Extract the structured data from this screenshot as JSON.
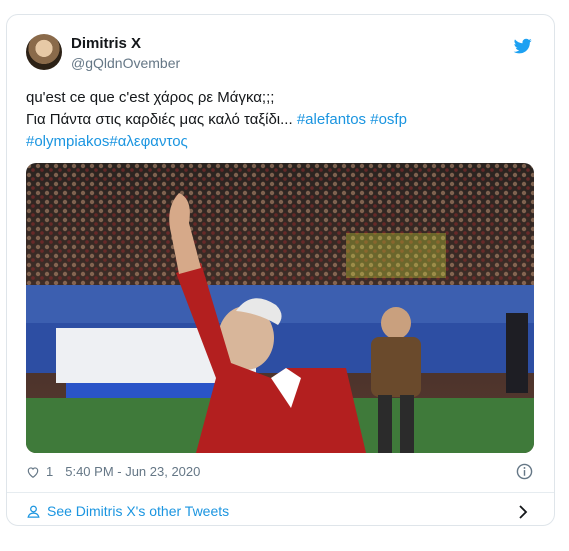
{
  "user": {
    "name": "Dimitris X",
    "handle": "@gQldnOvember"
  },
  "tweet": {
    "line1": "qu'est ce que c'est χάρος ρε Μάγκα;;;",
    "line2_text": "Για Πάντα στις καρδιές μας καλό ταξίδι...",
    "hashtag1": "#alefantos",
    "hashtag2": "#osfp",
    "hashtag3": "#olympiakos",
    "hashtag4": "#αλεφαντος"
  },
  "meta": {
    "like_count": "1",
    "timestamp": "5:40 PM - Jun 23, 2020"
  },
  "footer": {
    "link_label": "See Dimitris X's other Tweets"
  },
  "colors": {
    "link": "#1b95e0",
    "twitter_blue": "#1da1f2",
    "muted": "#657786"
  },
  "icons": [
    "twitter-bird-icon",
    "heart-icon",
    "info-icon",
    "person-icon",
    "chevron-right-icon"
  ]
}
